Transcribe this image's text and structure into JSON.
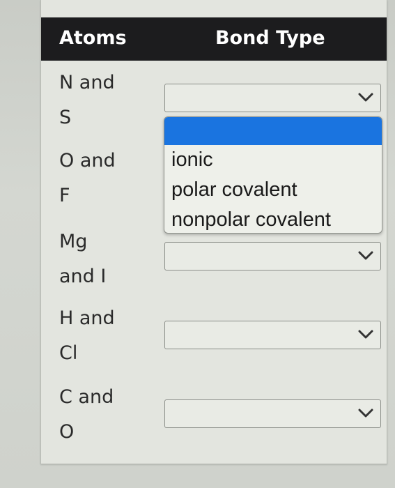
{
  "table": {
    "headers": {
      "atoms": "Atoms",
      "bond_type": "Bond Type"
    },
    "rows": [
      {
        "atoms_line1": "N and",
        "atoms_line2": "S",
        "selected": ""
      },
      {
        "atoms_line1": "O and",
        "atoms_line2": "F",
        "selected": ""
      },
      {
        "atoms_line1": "Mg",
        "atoms_line2": "and I",
        "selected": ""
      },
      {
        "atoms_line1": "H and",
        "atoms_line2": "Cl",
        "selected": ""
      },
      {
        "atoms_line1": "C and",
        "atoms_line2": "O",
        "selected": ""
      }
    ]
  },
  "dropdown": {
    "open_for_row": 0,
    "options": [
      "",
      "ionic",
      "polar covalent",
      "nonpolar covalent"
    ],
    "highlighted_index": 0,
    "highlight_color": "#1a74e0"
  },
  "icons": {
    "select_arrow": "chevron-down-icon"
  },
  "colors": {
    "header_bg": "#1c1c1e",
    "header_text": "#ffffff",
    "card_bg": "#e3e5df"
  }
}
